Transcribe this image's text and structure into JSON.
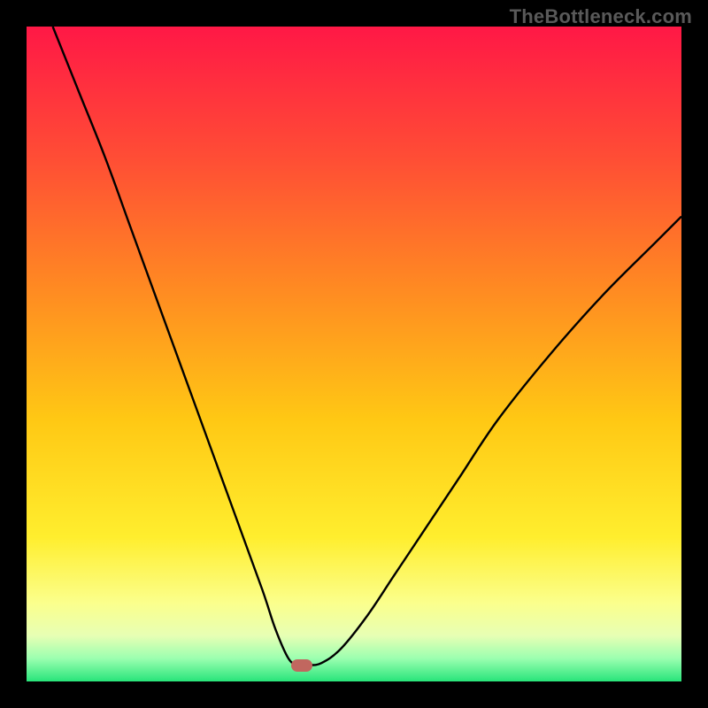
{
  "watermark": "TheBottleneck.com",
  "colors": {
    "frame_bg": "#000000",
    "curve_stroke": "#000000",
    "marker_fill": "#c1675f",
    "watermark_text": "#595959"
  },
  "gradient_stops": [
    {
      "offset": 0.0,
      "color": "#ff1846"
    },
    {
      "offset": 0.2,
      "color": "#ff4d35"
    },
    {
      "offset": 0.4,
      "color": "#ff8a22"
    },
    {
      "offset": 0.6,
      "color": "#ffc814"
    },
    {
      "offset": 0.78,
      "color": "#ffee2e"
    },
    {
      "offset": 0.88,
      "color": "#fbff8c"
    },
    {
      "offset": 0.93,
      "color": "#e7ffb4"
    },
    {
      "offset": 0.965,
      "color": "#9bffb0"
    },
    {
      "offset": 1.0,
      "color": "#28e47a"
    }
  ],
  "chart_data": {
    "type": "line",
    "title": "",
    "xlabel": "",
    "ylabel": "",
    "xlim": [
      0,
      100
    ],
    "ylim": [
      0,
      100
    ],
    "grid": false,
    "legend": false,
    "series": [
      {
        "name": "bottleneck-curve",
        "x": [
          4,
          8,
          12,
          16,
          20,
          24,
          28,
          32,
          36,
          38,
          40,
          41.5,
          43,
          45,
          48,
          52,
          56,
          60,
          66,
          72,
          80,
          88,
          96,
          100
        ],
        "y": [
          100,
          90,
          80,
          69,
          58,
          47,
          36,
          25,
          14,
          8,
          3.5,
          2.5,
          2.5,
          2.8,
          5,
          10,
          16,
          22,
          31,
          40,
          50,
          59,
          67,
          71
        ]
      }
    ],
    "optimal_marker": {
      "x": 42,
      "y": 2.5
    },
    "annotations": []
  }
}
